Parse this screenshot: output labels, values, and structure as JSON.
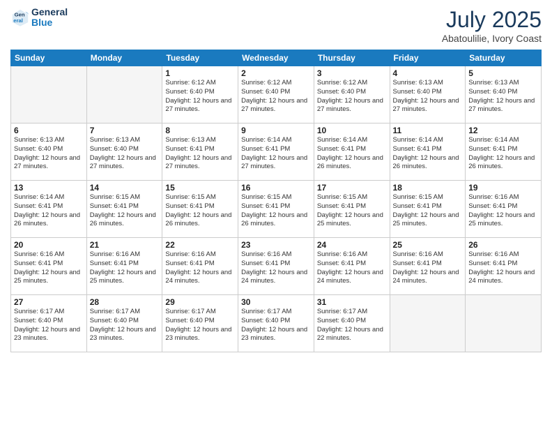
{
  "header": {
    "logo_line1": "General",
    "logo_line2": "Blue",
    "month": "July 2025",
    "location": "Abatoulilie, Ivory Coast"
  },
  "weekdays": [
    "Sunday",
    "Monday",
    "Tuesday",
    "Wednesday",
    "Thursday",
    "Friday",
    "Saturday"
  ],
  "weeks": [
    [
      {
        "day": "",
        "empty": true
      },
      {
        "day": "",
        "empty": true
      },
      {
        "day": "1",
        "sunrise": "Sunrise: 6:12 AM",
        "sunset": "Sunset: 6:40 PM",
        "daylight": "Daylight: 12 hours and 27 minutes."
      },
      {
        "day": "2",
        "sunrise": "Sunrise: 6:12 AM",
        "sunset": "Sunset: 6:40 PM",
        "daylight": "Daylight: 12 hours and 27 minutes."
      },
      {
        "day": "3",
        "sunrise": "Sunrise: 6:12 AM",
        "sunset": "Sunset: 6:40 PM",
        "daylight": "Daylight: 12 hours and 27 minutes."
      },
      {
        "day": "4",
        "sunrise": "Sunrise: 6:13 AM",
        "sunset": "Sunset: 6:40 PM",
        "daylight": "Daylight: 12 hours and 27 minutes."
      },
      {
        "day": "5",
        "sunrise": "Sunrise: 6:13 AM",
        "sunset": "Sunset: 6:40 PM",
        "daylight": "Daylight: 12 hours and 27 minutes."
      }
    ],
    [
      {
        "day": "6",
        "sunrise": "Sunrise: 6:13 AM",
        "sunset": "Sunset: 6:40 PM",
        "daylight": "Daylight: 12 hours and 27 minutes."
      },
      {
        "day": "7",
        "sunrise": "Sunrise: 6:13 AM",
        "sunset": "Sunset: 6:40 PM",
        "daylight": "Daylight: 12 hours and 27 minutes."
      },
      {
        "day": "8",
        "sunrise": "Sunrise: 6:13 AM",
        "sunset": "Sunset: 6:41 PM",
        "daylight": "Daylight: 12 hours and 27 minutes."
      },
      {
        "day": "9",
        "sunrise": "Sunrise: 6:14 AM",
        "sunset": "Sunset: 6:41 PM",
        "daylight": "Daylight: 12 hours and 27 minutes."
      },
      {
        "day": "10",
        "sunrise": "Sunrise: 6:14 AM",
        "sunset": "Sunset: 6:41 PM",
        "daylight": "Daylight: 12 hours and 26 minutes."
      },
      {
        "day": "11",
        "sunrise": "Sunrise: 6:14 AM",
        "sunset": "Sunset: 6:41 PM",
        "daylight": "Daylight: 12 hours and 26 minutes."
      },
      {
        "day": "12",
        "sunrise": "Sunrise: 6:14 AM",
        "sunset": "Sunset: 6:41 PM",
        "daylight": "Daylight: 12 hours and 26 minutes."
      }
    ],
    [
      {
        "day": "13",
        "sunrise": "Sunrise: 6:14 AM",
        "sunset": "Sunset: 6:41 PM",
        "daylight": "Daylight: 12 hours and 26 minutes."
      },
      {
        "day": "14",
        "sunrise": "Sunrise: 6:15 AM",
        "sunset": "Sunset: 6:41 PM",
        "daylight": "Daylight: 12 hours and 26 minutes."
      },
      {
        "day": "15",
        "sunrise": "Sunrise: 6:15 AM",
        "sunset": "Sunset: 6:41 PM",
        "daylight": "Daylight: 12 hours and 26 minutes."
      },
      {
        "day": "16",
        "sunrise": "Sunrise: 6:15 AM",
        "sunset": "Sunset: 6:41 PM",
        "daylight": "Daylight: 12 hours and 26 minutes."
      },
      {
        "day": "17",
        "sunrise": "Sunrise: 6:15 AM",
        "sunset": "Sunset: 6:41 PM",
        "daylight": "Daylight: 12 hours and 25 minutes."
      },
      {
        "day": "18",
        "sunrise": "Sunrise: 6:15 AM",
        "sunset": "Sunset: 6:41 PM",
        "daylight": "Daylight: 12 hours and 25 minutes."
      },
      {
        "day": "19",
        "sunrise": "Sunrise: 6:16 AM",
        "sunset": "Sunset: 6:41 PM",
        "daylight": "Daylight: 12 hours and 25 minutes."
      }
    ],
    [
      {
        "day": "20",
        "sunrise": "Sunrise: 6:16 AM",
        "sunset": "Sunset: 6:41 PM",
        "daylight": "Daylight: 12 hours and 25 minutes."
      },
      {
        "day": "21",
        "sunrise": "Sunrise: 6:16 AM",
        "sunset": "Sunset: 6:41 PM",
        "daylight": "Daylight: 12 hours and 25 minutes."
      },
      {
        "day": "22",
        "sunrise": "Sunrise: 6:16 AM",
        "sunset": "Sunset: 6:41 PM",
        "daylight": "Daylight: 12 hours and 24 minutes."
      },
      {
        "day": "23",
        "sunrise": "Sunrise: 6:16 AM",
        "sunset": "Sunset: 6:41 PM",
        "daylight": "Daylight: 12 hours and 24 minutes."
      },
      {
        "day": "24",
        "sunrise": "Sunrise: 6:16 AM",
        "sunset": "Sunset: 6:41 PM",
        "daylight": "Daylight: 12 hours and 24 minutes."
      },
      {
        "day": "25",
        "sunrise": "Sunrise: 6:16 AM",
        "sunset": "Sunset: 6:41 PM",
        "daylight": "Daylight: 12 hours and 24 minutes."
      },
      {
        "day": "26",
        "sunrise": "Sunrise: 6:16 AM",
        "sunset": "Sunset: 6:41 PM",
        "daylight": "Daylight: 12 hours and 24 minutes."
      }
    ],
    [
      {
        "day": "27",
        "sunrise": "Sunrise: 6:17 AM",
        "sunset": "Sunset: 6:40 PM",
        "daylight": "Daylight: 12 hours and 23 minutes."
      },
      {
        "day": "28",
        "sunrise": "Sunrise: 6:17 AM",
        "sunset": "Sunset: 6:40 PM",
        "daylight": "Daylight: 12 hours and 23 minutes."
      },
      {
        "day": "29",
        "sunrise": "Sunrise: 6:17 AM",
        "sunset": "Sunset: 6:40 PM",
        "daylight": "Daylight: 12 hours and 23 minutes."
      },
      {
        "day": "30",
        "sunrise": "Sunrise: 6:17 AM",
        "sunset": "Sunset: 6:40 PM",
        "daylight": "Daylight: 12 hours and 23 minutes."
      },
      {
        "day": "31",
        "sunrise": "Sunrise: 6:17 AM",
        "sunset": "Sunset: 6:40 PM",
        "daylight": "Daylight: 12 hours and 22 minutes."
      },
      {
        "day": "",
        "empty": true
      },
      {
        "day": "",
        "empty": true
      }
    ]
  ]
}
